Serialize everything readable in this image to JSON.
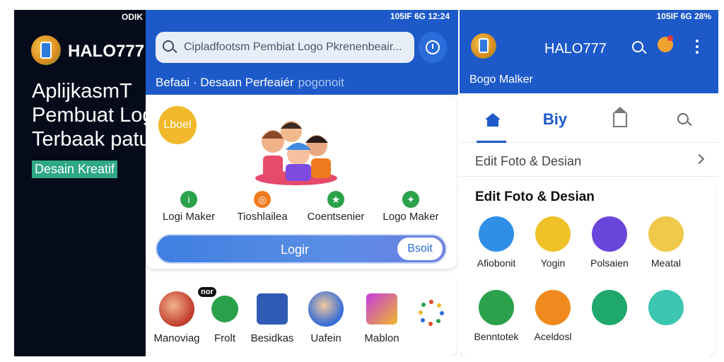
{
  "panel_left": {
    "status_text": "ODIK",
    "brand": "HALO777",
    "headline_lines": [
      "AplijkasmT",
      "Pembuat Log",
      "Terbaak patu"
    ],
    "tag": "Desain Kreatif"
  },
  "panel_middle": {
    "status_text": "105IF 6G 12:24",
    "search_placeholder": "Cipladfootsm Pembiat Logo Pkrenenbeair...",
    "subnav_primary": "Befaai · Desaan Perfeaiér",
    "subnav_secondary": "pogonoit",
    "badge_label": "Lboel",
    "tools": [
      {
        "label": "Logi Maker",
        "color": "#2aa14a"
      },
      {
        "label": "Tioshlailea",
        "color": "#f07a1e"
      },
      {
        "label": "Coentsenier",
        "color": "#2aa14a"
      },
      {
        "label": "Logo Maker",
        "color": "#2aa14a"
      }
    ],
    "login_label": "Logir",
    "login_pill": "Bsoit",
    "new_tag": "nor",
    "apps": [
      {
        "label": "Manoviag"
      },
      {
        "label": "Frolt"
      },
      {
        "label": "Besidkas"
      },
      {
        "label": "Uafein"
      },
      {
        "label": "Mablon"
      }
    ]
  },
  "panel_right": {
    "status_text": "105IF 6G 28%",
    "title": "HALO777",
    "subtitle": "Bogo Malker",
    "tab_text": "Biy",
    "row_label": "Edit Foto & Desian",
    "section_title": "Edit Foto & Desian",
    "apps": [
      {
        "label": "Afiobonit"
      },
      {
        "label": "Yogin"
      },
      {
        "label": "Polsaien"
      },
      {
        "label": "Meatal"
      },
      {
        "label": "Benntotek"
      },
      {
        "label": "Aceldosl"
      },
      {
        "label": ""
      },
      {
        "label": ""
      }
    ]
  },
  "colors": {
    "primary_blue": "#1d59c9",
    "dark_bg": "#060b1a",
    "tag_green": "#2fa886"
  }
}
